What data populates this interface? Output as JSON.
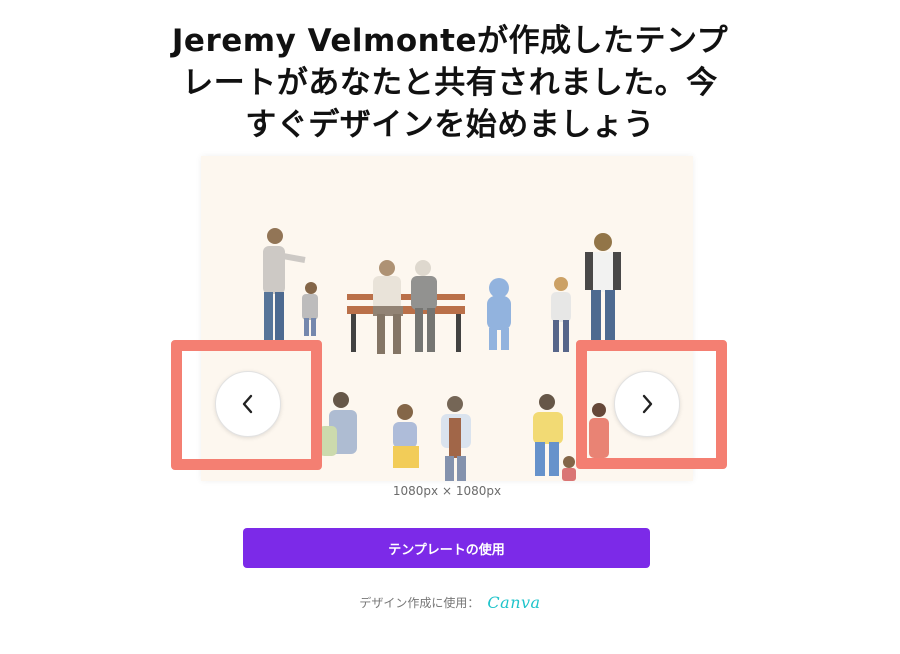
{
  "header": {
    "title": "Jeremy Velmonteが作成したテンプレートがあなたと共有されました。今すぐデザインを始めましょう"
  },
  "preview": {
    "dimensions": "1080px × 1080px",
    "prev_icon": "chevron-left-icon",
    "next_icon": "chevron-right-icon",
    "background_color": "#fdf7ef",
    "highlight_color": "#f47f72"
  },
  "actions": {
    "use_template_label": "テンプレートの使用",
    "button_color": "#7c2ae8"
  },
  "footer": {
    "made_with_label": "デザイン作成に使用：",
    "brand_logo": "Canva",
    "brand_color": "#20c4cb"
  }
}
